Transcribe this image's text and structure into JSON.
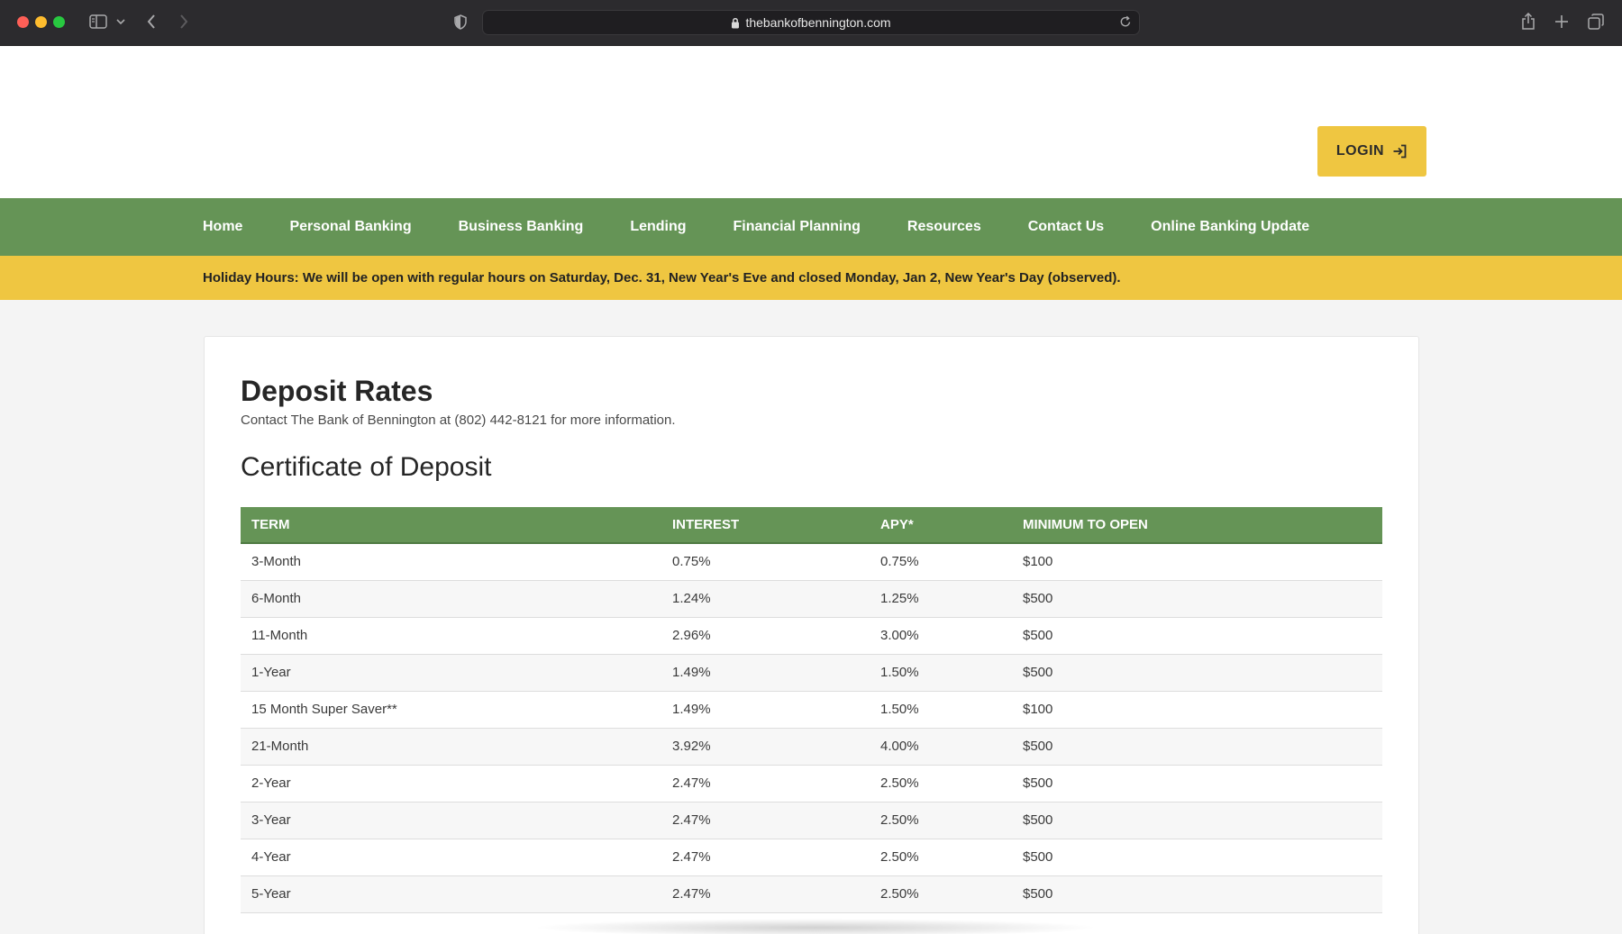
{
  "browser": {
    "url": "thebankofbennington.com",
    "icons": [
      "sidebar-icon",
      "chevron-down-icon",
      "back-icon",
      "forward-icon",
      "shield-icon",
      "lock-icon",
      "reload-icon",
      "share-icon",
      "plus-icon",
      "tabs-icon"
    ]
  },
  "header": {
    "login_label": "LOGIN",
    "login_icon": "login-arrow-icon"
  },
  "nav": {
    "items": [
      {
        "label": "Home"
      },
      {
        "label": "Personal Banking"
      },
      {
        "label": "Business Banking"
      },
      {
        "label": "Lending"
      },
      {
        "label": "Financial Planning"
      },
      {
        "label": "Resources"
      },
      {
        "label": "Contact Us"
      },
      {
        "label": "Online Banking Update"
      }
    ]
  },
  "alert": {
    "text": "Holiday Hours: We will be open with regular hours on Saturday, Dec. 31, New Year's Eve and closed Monday, Jan 2, New Year's Day (observed)."
  },
  "content": {
    "title": "Deposit Rates",
    "subtitle": "Contact The Bank of Bennington at (802) 442-8121 for more information.",
    "section_title": "Certificate of Deposit",
    "table": {
      "headers": [
        "TERM",
        "INTEREST",
        "APY*",
        "MINIMUM TO OPEN"
      ],
      "rows": [
        [
          "3-Month",
          "0.75%",
          "0.75%",
          "$100"
        ],
        [
          "6-Month",
          "1.24%",
          "1.25%",
          "$500"
        ],
        [
          "11-Month",
          "2.96%",
          "3.00%",
          "$500"
        ],
        [
          "1-Year",
          "1.49%",
          "1.50%",
          "$500"
        ],
        [
          "15 Month Super Saver**",
          "1.49%",
          "1.50%",
          "$100"
        ],
        [
          "21-Month",
          "3.92%",
          "4.00%",
          "$500"
        ],
        [
          "2-Year",
          "2.47%",
          "2.50%",
          "$500"
        ],
        [
          "3-Year",
          "2.47%",
          "2.50%",
          "$500"
        ],
        [
          "4-Year",
          "2.47%",
          "2.50%",
          "$500"
        ],
        [
          "5-Year",
          "2.47%",
          "2.50%",
          "$500"
        ]
      ]
    }
  },
  "colors": {
    "nav_green": "#659456",
    "accent_yellow": "#efc641",
    "chrome_dark": "#2c2b2e"
  }
}
